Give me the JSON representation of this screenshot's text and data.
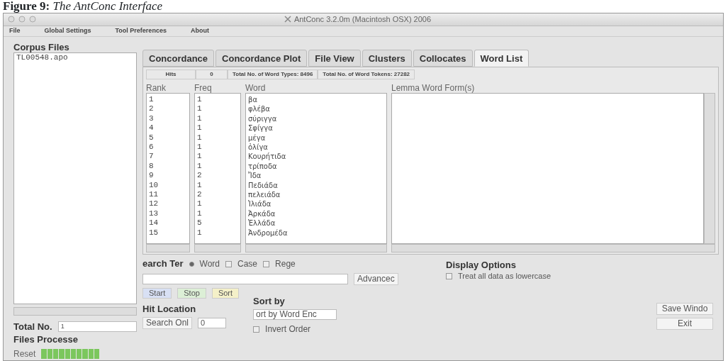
{
  "caption": "**Figure 9:** *The AntConc Interface*",
  "window": {
    "title": "AntConc 3.2.0m (Macintosh OSX) 2006"
  },
  "menu": [
    "File",
    "Global Settings",
    "Tool Preferences",
    "About"
  ],
  "corpus": {
    "heading": "Corpus Files",
    "files": [
      "TL00548.apo"
    ],
    "total_label": "Total No.",
    "total_value": "1",
    "processed_label": "Files Processe",
    "reset": "Reset",
    "progress": {
      "level": 1
    }
  },
  "tabs": [
    {
      "label": "Concordance",
      "selected": false
    },
    {
      "label": "Concordance Plot",
      "selected": false
    },
    {
      "label": "File View",
      "selected": false
    },
    {
      "label": "Clusters",
      "selected": false
    },
    {
      "label": "Collocates",
      "selected": false
    },
    {
      "label": "Word List",
      "selected": true
    }
  ],
  "stats": {
    "hits_label": "Hits",
    "hits_value": "0",
    "types": "Total No. of Word Types: 8496",
    "tokens": "Total No. of Word Tokens: 27282"
  },
  "columns": [
    "Rank",
    "Freq",
    "Word",
    "Lemma Word Form(s)"
  ],
  "rows": [
    {
      "rank": "1",
      "freq": "1",
      "word": "βα"
    },
    {
      "rank": "2",
      "freq": "1",
      "word": "φλέβα"
    },
    {
      "rank": "3",
      "freq": "1",
      "word": "σύριγγα"
    },
    {
      "rank": "4",
      "freq": "1",
      "word": "Σφίγγα"
    },
    {
      "rank": "5",
      "freq": "1",
      "word": "μέγα"
    },
    {
      "rank": "6",
      "freq": "1",
      "word": "ὀλίγα"
    },
    {
      "rank": "7",
      "freq": "1",
      "word": "Κουρήτιδα"
    },
    {
      "rank": "8",
      "freq": "1",
      "word": "τρίποδα"
    },
    {
      "rank": "9",
      "freq": "2",
      "word": "Ἴδα"
    },
    {
      "rank": "10",
      "freq": "1",
      "word": "Πεδιάδα"
    },
    {
      "rank": "11",
      "freq": "2",
      "word": "πελειάδα"
    },
    {
      "rank": "12",
      "freq": "1",
      "word": "Ἰλιάδα"
    },
    {
      "rank": "13",
      "freq": "1",
      "word": "Ἀρκάδα"
    },
    {
      "rank": "14",
      "freq": "5",
      "word": "Ἑλλάδα"
    },
    {
      "rank": "15",
      "freq": "1",
      "word": "Ἀνδρομέδα"
    }
  ],
  "search": {
    "label": "earch Ter",
    "options": [
      {
        "label": "Word",
        "kind": "radio",
        "checked": true
      },
      {
        "label": "Case",
        "kind": "checkbox",
        "checked": false
      },
      {
        "label": "Rege",
        "kind": "checkbox",
        "checked": false
      }
    ],
    "advanced": "Advancec"
  },
  "actions": [
    {
      "label": "Start",
      "color": "#d8e0f4"
    },
    {
      "label": "Stop",
      "color": "#dcefd6"
    },
    {
      "label": "Sort",
      "color": "#f4f0c8"
    }
  ],
  "hit_location": {
    "heading": "Hit Location",
    "button": "Search Onl",
    "value": "0"
  },
  "sort": {
    "heading": "Sort by",
    "value": "ort by Word Enc",
    "invert": {
      "label": "Invert Order",
      "checked": false
    }
  },
  "display": {
    "heading": "Display Options",
    "lowercase": {
      "label": "Treat all data as lowercase",
      "checked": false
    }
  },
  "footer_buttons": [
    "Save Windo",
    "Exit"
  ]
}
